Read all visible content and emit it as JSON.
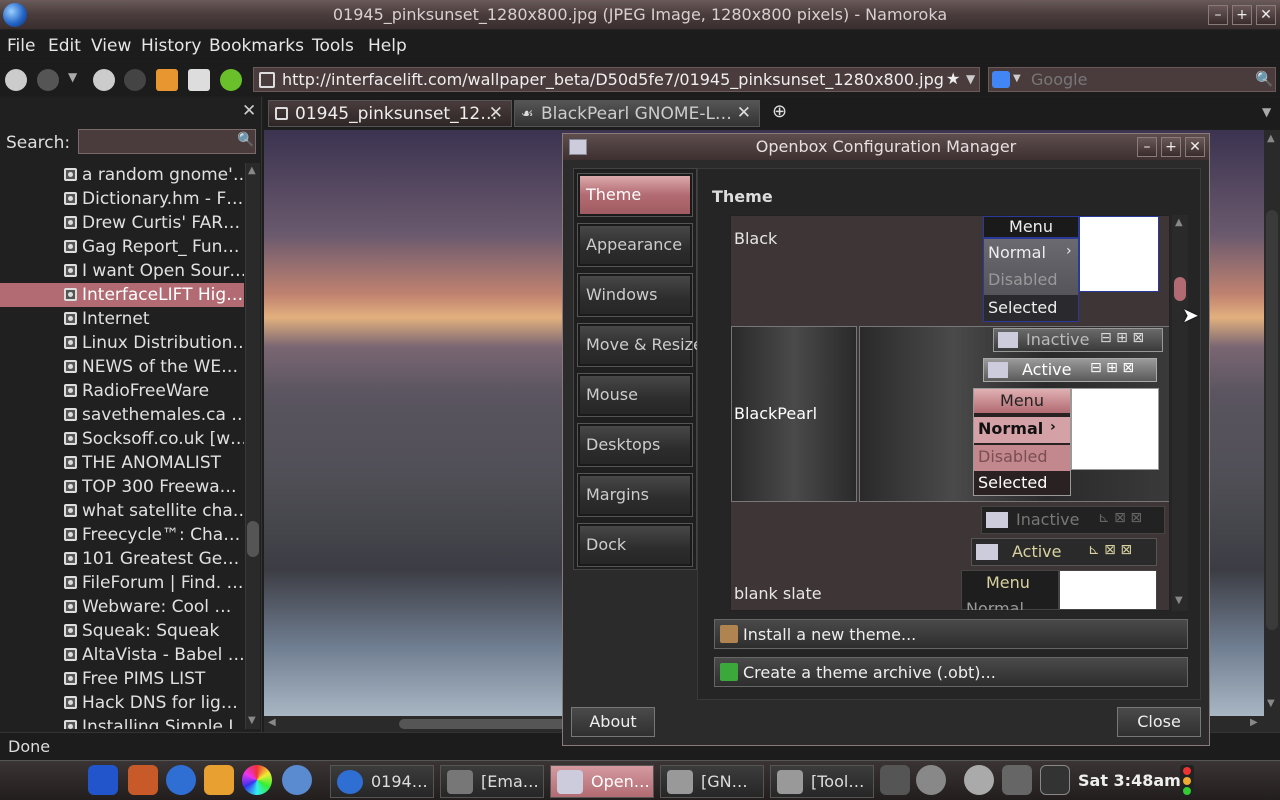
{
  "browser": {
    "window_title": "01945_pinksunset_1280x800.jpg (JPEG Image, 1280x800 pixels) - Namoroka",
    "menus": [
      "File",
      "Edit",
      "View",
      "History",
      "Bookmarks",
      "Tools",
      "Help"
    ],
    "url": "http://interfacelift.com/wallpaper_beta/D50d5fe7/01945_pinksunset_1280x800.jpg",
    "search_placeholder": "Google",
    "tabs": [
      {
        "label": "01945_pinksunset_12…",
        "active": true
      },
      {
        "label": "BlackPearl GNOME-L…",
        "active": false
      }
    ],
    "status": "Done"
  },
  "sidebar": {
    "search_label": "Search:",
    "bookmarks": [
      "a random gnome'…",
      "Dictionary.hm - F…",
      "Drew Curtis' FAR…",
      "Gag Report_ Fun…",
      "I want Open Sour…",
      "InterfaceLIFT Hig…",
      "Internet",
      "Linux Distribution…",
      "NEWS of the WE…",
      "RadioFreeWare",
      "savethemales.ca …",
      "Socksoff.co.uk [w…",
      "THE ANOMALIST",
      "TOP 300 Freewa…",
      "what satellite cha…",
      "Freecycle™: Cha…",
      "101 Greatest Ge…",
      "FileForum | Find. …",
      "Webware: Cool …",
      "Squeak: Squeak",
      "AltaVista - Babel …",
      "Free PIMS LIST",
      "Hack DNS for lig…",
      "Installing Simple L…"
    ],
    "selected_index": 5
  },
  "dialog": {
    "title": "Openbox Configuration Manager",
    "nav": [
      "Theme",
      "Appearance",
      "Windows",
      "Move & Resize",
      "Mouse",
      "Desktops",
      "Margins",
      "Dock"
    ],
    "active_nav": "Theme",
    "panel_heading": "Theme",
    "themes": [
      {
        "name": "Black",
        "menu_title": "Menu",
        "items": [
          "Normal",
          "Disabled",
          "Selected"
        ]
      },
      {
        "name": "BlackPearl",
        "inactive_label": "Inactive",
        "active_label": "Active",
        "menu_title": "Menu",
        "items": [
          "Normal",
          "Disabled",
          "Selected"
        ]
      },
      {
        "name": "blank slate",
        "inactive_label": "Inactive",
        "active_label": "Active",
        "menu_title": "Menu",
        "items": [
          "Normal"
        ]
      }
    ],
    "install_label": "Install a new theme...",
    "archive_label": "Create a theme archive (.obt)...",
    "about_label": "About",
    "close_label": "Close"
  },
  "taskbar": {
    "apps": [
      {
        "label": "0194…",
        "active": false
      },
      {
        "label": "[Ema…",
        "active": false
      },
      {
        "label": "Open…",
        "active": true
      },
      {
        "label": "[GN…",
        "active": false
      },
      {
        "label": "[Tool…",
        "active": false
      }
    ],
    "clock": "Sat  3:48am"
  },
  "colors": {
    "accent": "#b26b72",
    "bar": "#1c1c1c"
  }
}
